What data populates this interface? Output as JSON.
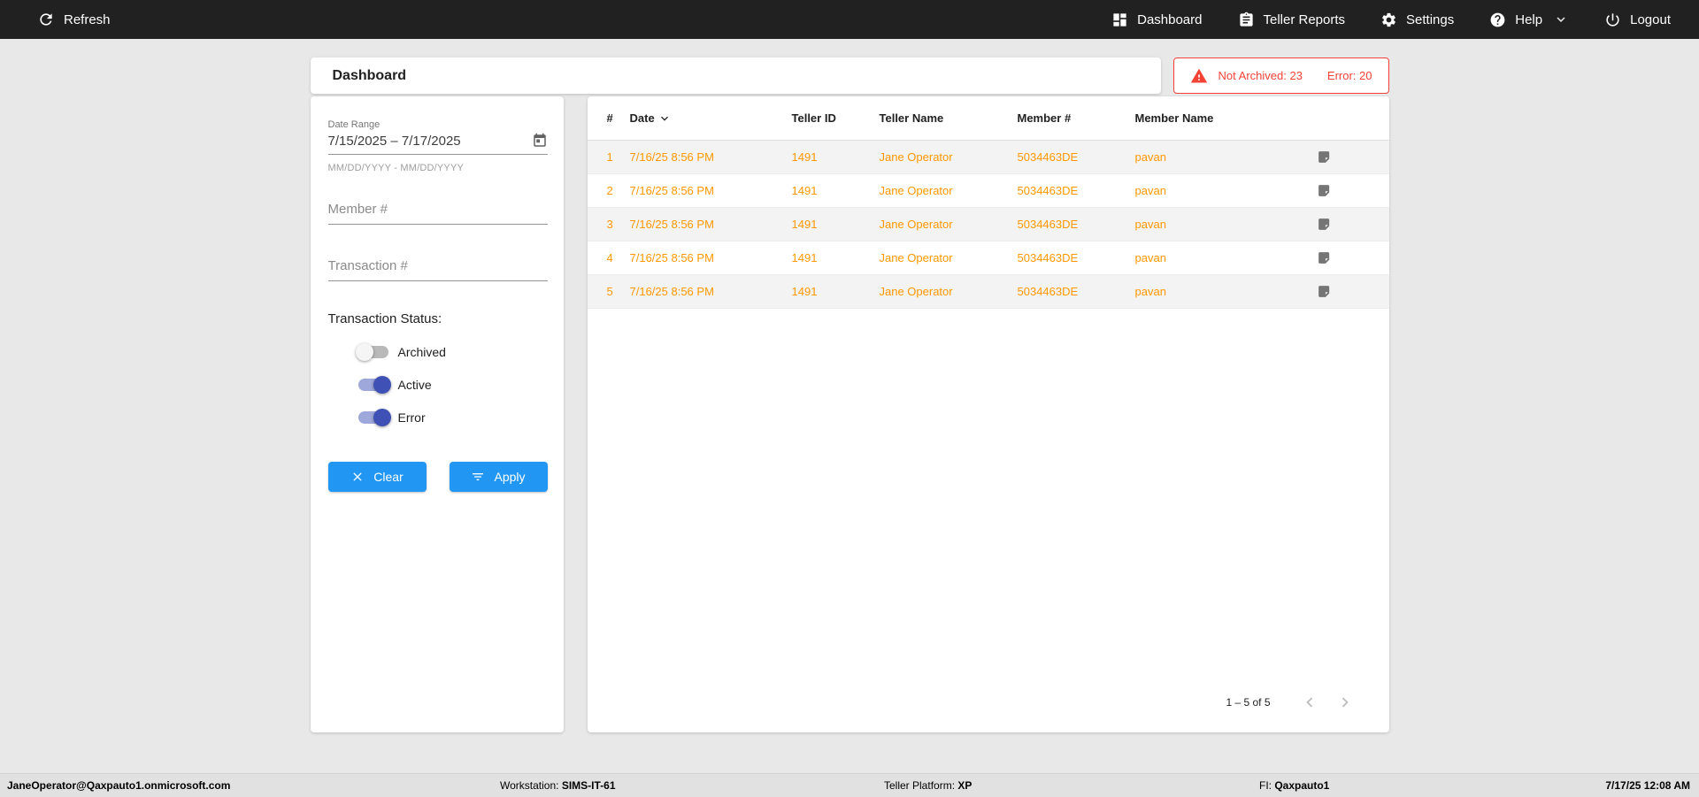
{
  "topbar": {
    "refresh_label": "Refresh",
    "dashboard_label": "Dashboard",
    "reports_label": "Teller Reports",
    "settings_label": "Settings",
    "help_label": "Help",
    "logout_label": "Logout"
  },
  "header": {
    "title": "Dashboard",
    "alert_not_archived": "Not Archived: 23",
    "alert_error": "Error: 20"
  },
  "filters": {
    "date_range_label": "Date Range",
    "date_range_value": "7/15/2025 – 7/17/2025",
    "date_range_hint": "MM/DD/YYYY - MM/DD/YYYY",
    "member_placeholder": "Member #",
    "transaction_placeholder": "Transaction #",
    "status_label": "Transaction Status:",
    "toggles": [
      {
        "label": "Archived",
        "on": false
      },
      {
        "label": "Active",
        "on": true
      },
      {
        "label": "Error",
        "on": true
      }
    ],
    "clear_label": "Clear",
    "apply_label": "Apply"
  },
  "table": {
    "columns": {
      "num": "#",
      "date": "Date",
      "teller_id": "Teller ID",
      "teller_name": "Teller Name",
      "member_num": "Member #",
      "member_name": "Member Name"
    },
    "sort": {
      "column": "Date",
      "direction": "desc"
    },
    "rows": [
      {
        "num": "1",
        "date": "7/16/25 8:56 PM",
        "teller_id": "1491",
        "teller_name": "Jane Operator",
        "member_num": "5034463DE",
        "member_name": "pavan"
      },
      {
        "num": "2",
        "date": "7/16/25 8:56 PM",
        "teller_id": "1491",
        "teller_name": "Jane Operator",
        "member_num": "5034463DE",
        "member_name": "pavan"
      },
      {
        "num": "3",
        "date": "7/16/25 8:56 PM",
        "teller_id": "1491",
        "teller_name": "Jane Operator",
        "member_num": "5034463DE",
        "member_name": "pavan"
      },
      {
        "num": "4",
        "date": "7/16/25 8:56 PM",
        "teller_id": "1491",
        "teller_name": "Jane Operator",
        "member_num": "5034463DE",
        "member_name": "pavan"
      },
      {
        "num": "5",
        "date": "7/16/25 8:56 PM",
        "teller_id": "1491",
        "teller_name": "Jane Operator",
        "member_num": "5034463DE",
        "member_name": "pavan"
      }
    ],
    "pagination_range": "1 – 5 of 5"
  },
  "footer": {
    "user": "JaneOperator@Qaxpauto1.onmicrosoft.com",
    "workstation_label": "Workstation:",
    "workstation_value": "SIMS-IT-61",
    "platform_label": "Teller Platform:",
    "platform_value": "XP",
    "fi_label": "FI:",
    "fi_value": "Qaxpauto1",
    "timestamp": "7/17/25 12:08 AM"
  },
  "colors": {
    "accent_blue": "#2196f3",
    "toggle_indigo": "#3f51b5",
    "row_orange": "#ff9800",
    "alert_red": "#f44336",
    "topbar_dark": "#212121"
  }
}
